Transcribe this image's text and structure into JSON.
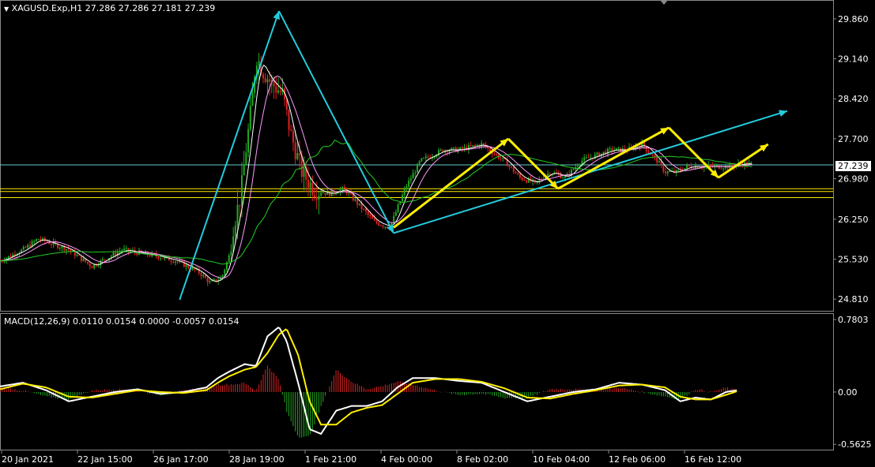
{
  "header": {
    "symbol_line": "XAGUSD.Exp,H1  27.286 27.286 27.181 27.239",
    "macd_line": "MACD(12,26,9) 0.0110 0.0154 0.0000 -0.0057 0.0154"
  },
  "colors": {
    "background": "#000000",
    "bull": "#22aa22",
    "bear": "#dd2222",
    "ma_fast": "#ffffff",
    "ma_mid": "#ff99ff",
    "ma_slow": "#22cc22",
    "trend_cyan": "#22ccdd",
    "trend_yellow": "#ffee00",
    "hline_yellow": "#ffee00",
    "hline_cyan": "#66cccc",
    "macd_line": "#ffffff",
    "signal_line": "#ffee00"
  },
  "current_price": "27.239",
  "chart_data": [
    {
      "type": "line",
      "title": "XAGUSD.Exp,H1",
      "ylim": [
        24.6,
        30.2
      ],
      "y_ticks": [
        "29.860",
        "29.140",
        "28.420",
        "27.700",
        "26.980",
        "26.250",
        "25.530",
        "24.810"
      ],
      "x_ticks": [
        "20 Jan 2021",
        "22 Jan 15:00",
        "26 Jan 17:00",
        "28 Jan 19:00",
        "1 Feb 21:00",
        "4 Feb 00:00",
        "8 Feb 02:00",
        "10 Feb 04:00",
        "12 Feb 06:00",
        "16 Feb 12:00"
      ],
      "series": [
        {
          "x": [
            0,
            0.3,
            0.5,
            0.9,
            1.2,
            1.6,
            2.0,
            2.3,
            2.6,
            2.75,
            2.9,
            3.0,
            3.05,
            3.1,
            3.15,
            3.2,
            3.3,
            3.35,
            3.45,
            3.55,
            3.7,
            3.8,
            3.95,
            4.1,
            4.3,
            4.5,
            4.7,
            4.9,
            5.1,
            5.3,
            5.5,
            5.8,
            6.0,
            6.3,
            6.6,
            6.8,
            7.0,
            7.2,
            7.4,
            7.6,
            7.8,
            8.0,
            8.2,
            8.4,
            8.6,
            8.7,
            8.85,
            9.0,
            9.2,
            9.4,
            9.55,
            9.7,
            9.85
          ],
          "values": [
            25.5,
            25.7,
            25.9,
            25.7,
            25.4,
            25.7,
            25.6,
            25.5,
            25.3,
            25.1,
            25.2,
            25.6,
            26.1,
            26.4,
            26.7,
            27.3,
            28.4,
            29.2,
            28.9,
            28.7,
            28.5,
            27.8,
            27.1,
            26.8,
            26.7,
            26.8,
            26.5,
            26.2,
            26.1,
            26.8,
            27.3,
            27.5,
            27.5,
            27.6,
            27.3,
            27.0,
            26.9,
            27.1,
            27.0,
            27.3,
            27.4,
            27.5,
            27.5,
            27.6,
            27.3,
            27.1,
            27.1,
            27.2,
            27.2,
            27.2,
            27.2,
            27.25,
            27.24
          ]
        }
      ],
      "trend_lines": [
        {
          "color": "cyan",
          "points": [
            [
              2.35,
              24.8
            ],
            [
              3.65,
              30.0
            ]
          ]
        },
        {
          "color": "cyan",
          "points": [
            [
              3.65,
              30.0
            ],
            [
              5.15,
              26.0
            ]
          ]
        },
        {
          "color": "cyan",
          "points": [
            [
              5.15,
              26.0
            ],
            [
              10.3,
              28.2
            ]
          ]
        },
        {
          "color": "yellow",
          "points": [
            [
              5.15,
              26.1
            ],
            [
              6.65,
              27.7
            ],
            [
              7.3,
              26.8
            ],
            [
              8.75,
              27.9
            ],
            [
              9.4,
              27.0
            ],
            [
              10.05,
              27.6
            ]
          ]
        }
      ],
      "horizontal_lines": [
        {
          "color": "cyan",
          "value": 27.23
        },
        {
          "color": "yellow",
          "value": 26.8
        },
        {
          "color": "yellow",
          "value": 26.75
        },
        {
          "color": "yellow",
          "value": 26.64
        }
      ]
    },
    {
      "type": "line",
      "title": "MACD(12,26,9)",
      "ylim": [
        -0.62,
        0.84
      ],
      "y_ticks": [
        "0.7803",
        "0.00",
        "-0.5625"
      ],
      "series": [
        {
          "name": "MACD",
          "x": [
            0,
            0.3,
            0.6,
            0.9,
            1.2,
            1.5,
            1.8,
            2.1,
            2.4,
            2.7,
            2.85,
            3.0,
            3.2,
            3.35,
            3.5,
            3.65,
            3.75,
            3.9,
            4.05,
            4.2,
            4.4,
            4.6,
            4.8,
            5.0,
            5.2,
            5.4,
            5.7,
            6.0,
            6.3,
            6.6,
            6.9,
            7.2,
            7.5,
            7.8,
            8.1,
            8.4,
            8.7,
            8.9,
            9.1,
            9.3,
            9.5,
            9.65
          ],
          "values": [
            0.06,
            0.1,
            0.02,
            -0.1,
            -0.05,
            0.0,
            0.03,
            -0.02,
            0.0,
            0.05,
            0.15,
            0.22,
            0.3,
            0.28,
            0.6,
            0.7,
            0.55,
            0.1,
            -0.4,
            -0.45,
            -0.2,
            -0.15,
            -0.15,
            -0.1,
            0.05,
            0.15,
            0.15,
            0.12,
            0.1,
            0.0,
            -0.1,
            -0.05,
            0.0,
            0.03,
            0.1,
            0.08,
            0.02,
            -0.1,
            -0.06,
            -0.08,
            0.0,
            0.02
          ]
        },
        {
          "name": "Signal",
          "x": [
            0,
            0.3,
            0.6,
            0.9,
            1.2,
            1.5,
            1.8,
            2.1,
            2.4,
            2.7,
            2.85,
            3.0,
            3.2,
            3.35,
            3.5,
            3.65,
            3.75,
            3.9,
            4.05,
            4.2,
            4.4,
            4.6,
            4.8,
            5.0,
            5.2,
            5.4,
            5.7,
            6.0,
            6.3,
            6.6,
            6.9,
            7.2,
            7.5,
            7.8,
            8.1,
            8.4,
            8.7,
            8.9,
            9.1,
            9.3,
            9.5,
            9.65
          ],
          "values": [
            0.03,
            0.09,
            0.05,
            -0.05,
            -0.06,
            -0.02,
            0.02,
            0.0,
            -0.01,
            0.02,
            0.1,
            0.17,
            0.24,
            0.27,
            0.42,
            0.62,
            0.68,
            0.4,
            -0.1,
            -0.35,
            -0.35,
            -0.22,
            -0.17,
            -0.14,
            -0.02,
            0.1,
            0.14,
            0.14,
            0.11,
            0.04,
            -0.06,
            -0.07,
            -0.02,
            0.02,
            0.07,
            0.08,
            0.05,
            -0.05,
            -0.08,
            -0.08,
            -0.03,
            0.01
          ]
        }
      ]
    }
  ]
}
